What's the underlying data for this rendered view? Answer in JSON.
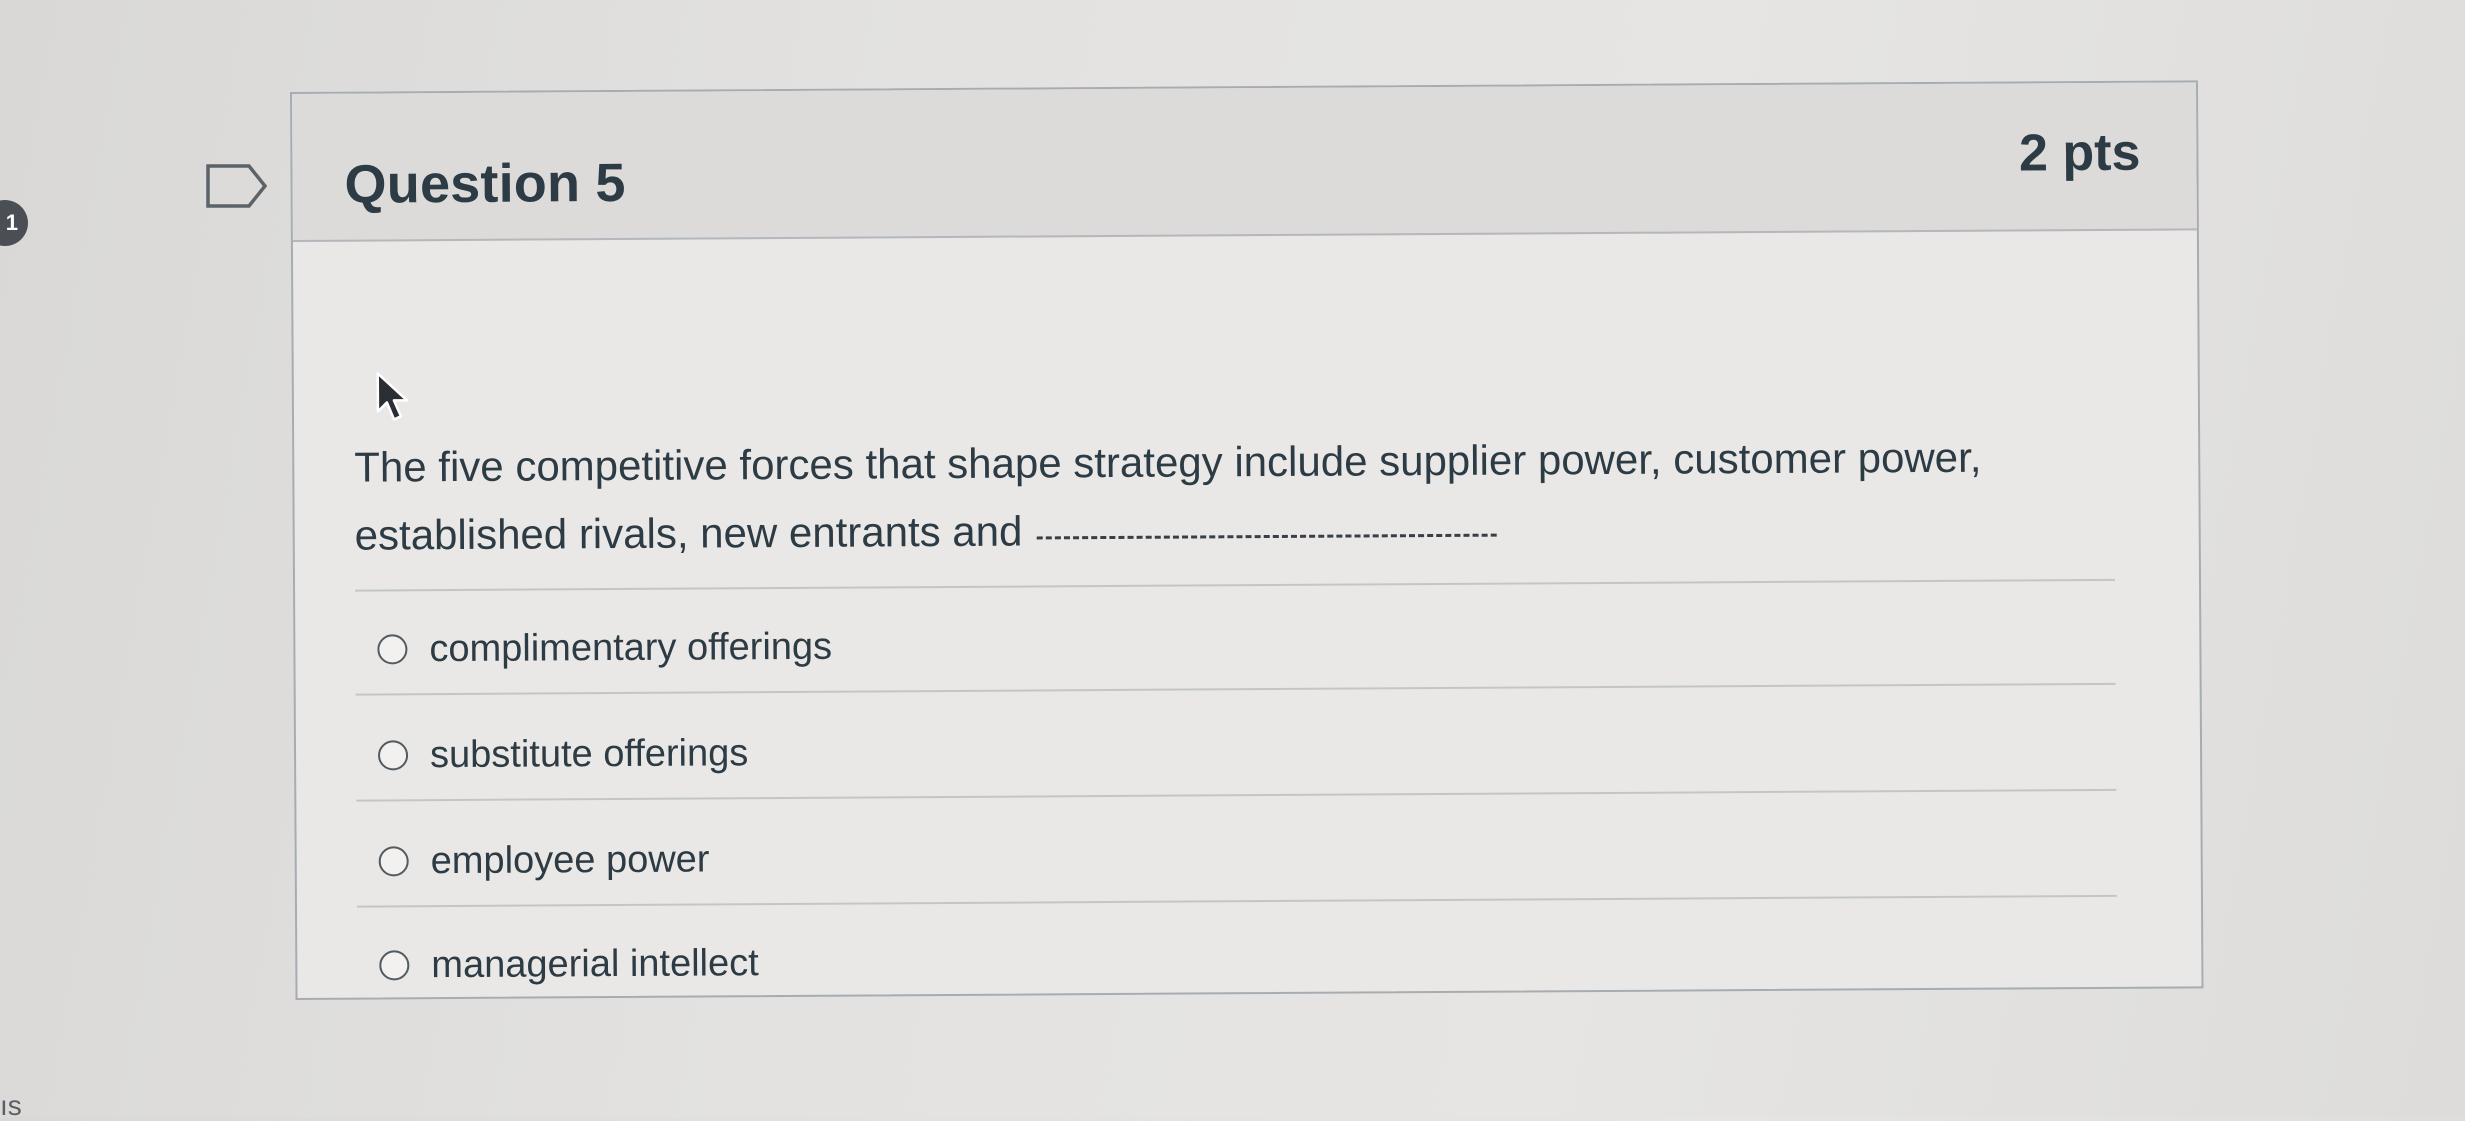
{
  "side_badge": "1",
  "side_text": "ıs",
  "question": {
    "title": "Question 5",
    "points": "2 pts",
    "text": "The five competitive forces that shape strategy include supplier power, customer power, established rivals, new entrants and",
    "answers": [
      {
        "label": "complimentary offerings"
      },
      {
        "label": "substitute offerings"
      },
      {
        "label": "employee power"
      },
      {
        "label": "managerial intellect"
      }
    ]
  },
  "icons": {
    "flag": "bookmark-flag-icon",
    "cursor": "mouse-pointer-icon"
  }
}
